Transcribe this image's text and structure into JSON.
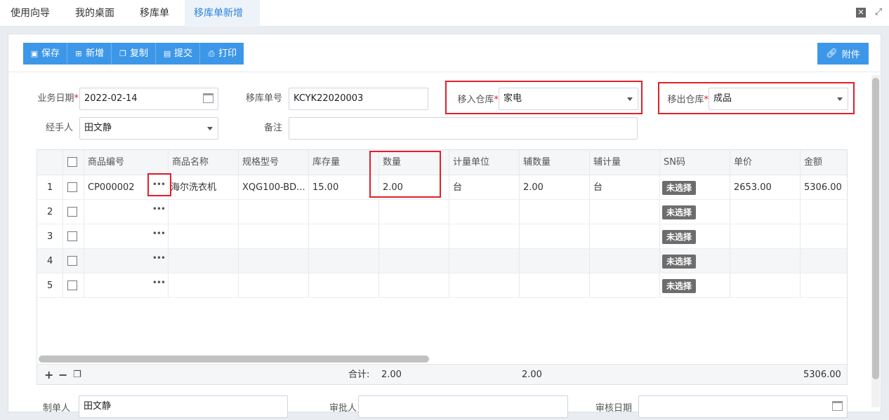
{
  "tabs": [
    {
      "label": "使用向导",
      "active": false
    },
    {
      "label": "我的桌面",
      "active": false
    },
    {
      "label": "移库单",
      "active": false
    },
    {
      "label": "移库单新增",
      "active": true
    }
  ],
  "toolbar": {
    "save": "保存",
    "add": "新增",
    "copy": "复制",
    "submit": "提交",
    "print": "打印",
    "attach": "附件"
  },
  "form": {
    "date_label": "业务日期",
    "date_value": "2022-02-14",
    "no_label": "移库单号",
    "no_value": "KCYK22020003",
    "in_label": "移入仓库",
    "in_value": "家电",
    "out_label": "移出仓库",
    "out_value": "成品",
    "handler_label": "经手人",
    "handler_value": "田文静",
    "remark_label": "备注",
    "remark_value": ""
  },
  "grid": {
    "columns": [
      "商品编号",
      "商品名称",
      "规格型号",
      "库存量",
      "数量",
      "计量单位",
      "辅数量",
      "辅计量",
      "SN码",
      "单价",
      "金额"
    ],
    "rows": [
      {
        "no": "1",
        "code": "CP000002",
        "name": "海尔洗衣机",
        "spec": "XQG100-BD...",
        "stock": "15.00",
        "qty": "2.00",
        "unit": "台",
        "aux_qty": "2.00",
        "aux_unit": "台",
        "sn": "未选择",
        "price": "2653.00",
        "amount": "5306.00"
      },
      {
        "no": "2",
        "code": "",
        "name": "",
        "spec": "",
        "stock": "",
        "qty": "",
        "unit": "",
        "aux_qty": "",
        "aux_unit": "",
        "sn": "未选择",
        "price": "",
        "amount": ""
      },
      {
        "no": "3",
        "code": "",
        "name": "",
        "spec": "",
        "stock": "",
        "qty": "",
        "unit": "",
        "aux_qty": "",
        "aux_unit": "",
        "sn": "未选择",
        "price": "",
        "amount": ""
      },
      {
        "no": "4",
        "code": "",
        "name": "",
        "spec": "",
        "stock": "",
        "qty": "",
        "unit": "",
        "aux_qty": "",
        "aux_unit": "",
        "sn": "未选择",
        "price": "",
        "amount": ""
      },
      {
        "no": "5",
        "code": "",
        "name": "",
        "spec": "",
        "stock": "",
        "qty": "",
        "unit": "",
        "aux_qty": "",
        "aux_unit": "",
        "sn": "未选择",
        "price": "",
        "amount": ""
      }
    ],
    "footer": {
      "total_label": "合计:",
      "total_qty": "2.00",
      "total_aux_qty": "2.00",
      "total_amount": "5306.00"
    }
  },
  "bottom_form": {
    "maker_label": "制单人",
    "maker_value": "田文静",
    "auditor_label": "审批人",
    "audit_date_label": "审核日期"
  },
  "colors": {
    "accent": "#3d97e8",
    "highlight": "#e0202a",
    "sn_badge": "#6d6d6d"
  }
}
